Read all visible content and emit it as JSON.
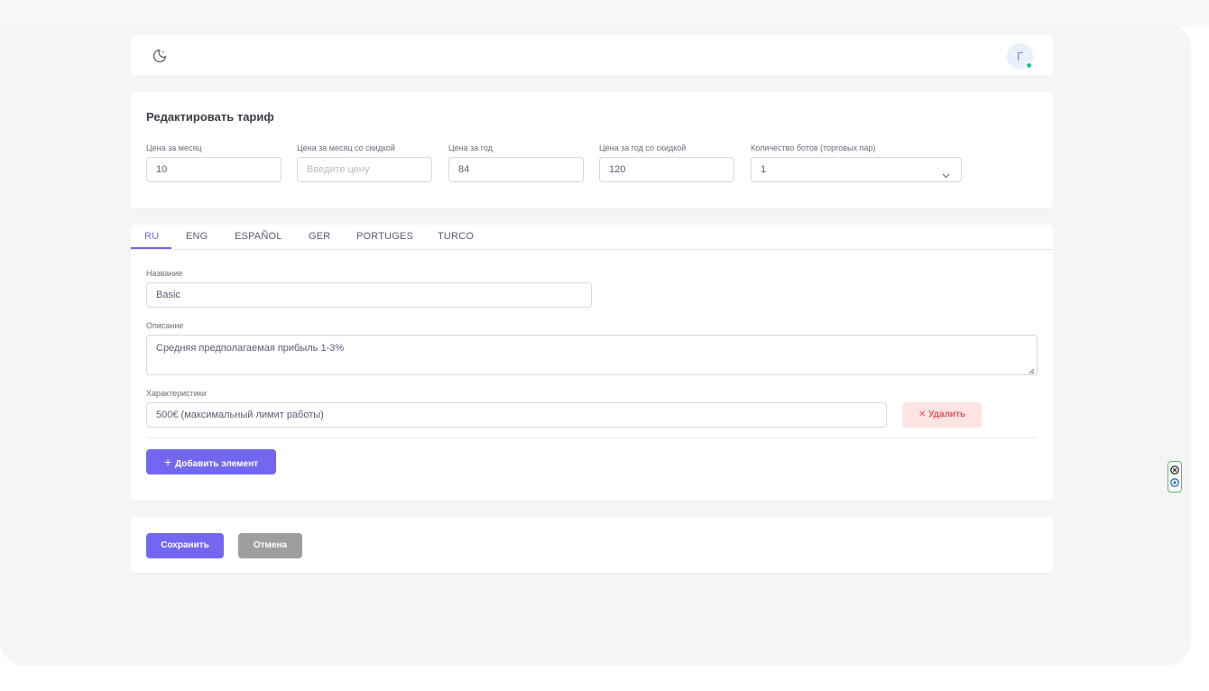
{
  "header": {
    "theme_icon": "moon-icon",
    "avatar_initial": "Г"
  },
  "tariff": {
    "title": "Редактировать тариф",
    "fields": [
      {
        "label": "Цена за месяц",
        "value": "10",
        "placeholder": ""
      },
      {
        "label": "Цена за месяц со скидкой",
        "value": "",
        "placeholder": "Введите цену"
      },
      {
        "label": "Цена за год",
        "value": "84",
        "placeholder": ""
      },
      {
        "label": "Цена за год со скидкой",
        "value": "120",
        "placeholder": ""
      }
    ],
    "bots": {
      "label": "Количество ботов (торговых пар)",
      "value": "1"
    }
  },
  "tabs": [
    {
      "label": "RU",
      "active": true
    },
    {
      "label": "ENG",
      "active": false
    },
    {
      "label": "ESPAÑOL",
      "active": false
    },
    {
      "label": "GER",
      "active": false
    },
    {
      "label": "PORTUGES",
      "active": false
    },
    {
      "label": "TURCO",
      "active": false
    }
  ],
  "form": {
    "name_label": "Название",
    "name_value": "Basic",
    "description_label": "Описание",
    "description_value": "Средняя предполагаемая прибыль 1-3%",
    "features_label": "Характеристики",
    "feature_value": "500€ (максимальный лимит работы)",
    "delete_label": "Удалить",
    "add_label": "Добавить элемент"
  },
  "actions": {
    "save_label": "Сохранить",
    "cancel_label": "Отмена"
  },
  "colors": {
    "accent": "#7367f0",
    "danger": "#ea5455",
    "danger_bg": "#fce4e4",
    "online": "#28c76f",
    "secondary_button": "#9e9e9e"
  }
}
